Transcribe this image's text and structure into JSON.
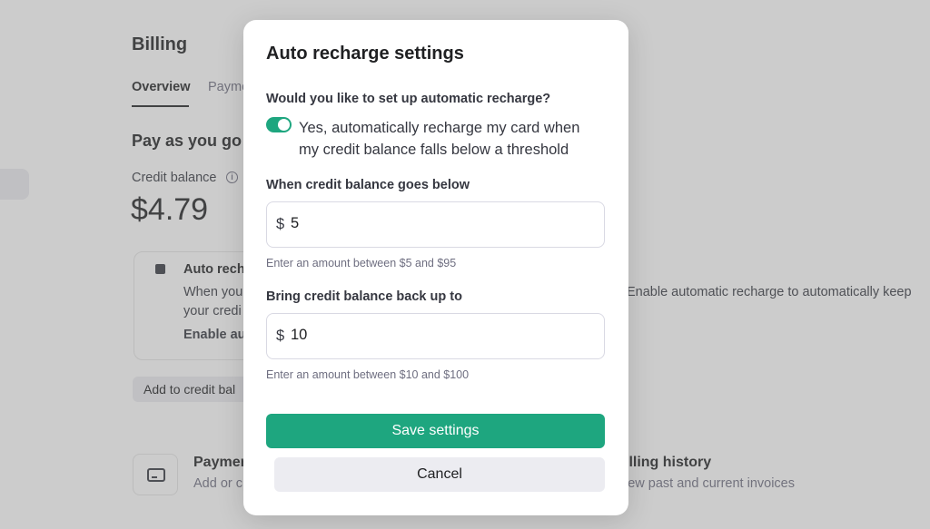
{
  "background": {
    "page_title": "Billing",
    "tabs": [
      {
        "label": "Overview"
      },
      {
        "label": "Payme"
      }
    ],
    "section_title": "Pay as you go",
    "credit_balance_label": "Credit balance",
    "info_icon": "info-icon",
    "credit_balance_amount": "$4.79",
    "auto_recharge_card": {
      "title": "Auto recha",
      "line1": "When you",
      "line2": "your credi",
      "link": "Enable au"
    },
    "auto_recharge_right_text": "Enable automatic recharge to automatically keep",
    "add_credit_button": "Add to credit bal",
    "payment_methods": {
      "icon": "credit-card-icon",
      "title": "Paymer",
      "subtitle": "Add or c"
    },
    "billing_history": {
      "title": "illing history",
      "subtitle": "iew past and current invoices"
    }
  },
  "modal": {
    "title": "Auto recharge settings",
    "question": "Would you like to set up automatic recharge?",
    "toggle": {
      "enabled": true,
      "color": "#1ea67f",
      "label": "Yes, automatically recharge my card when my credit balance falls below a threshold"
    },
    "threshold": {
      "label": "When credit balance goes below",
      "currency": "$",
      "value": "5",
      "hint": "Enter an amount between $5 and $95"
    },
    "recharge_to": {
      "label": "Bring credit balance back up to",
      "currency": "$",
      "value": "10",
      "hint": "Enter an amount between $10 and $100"
    },
    "save_label": "Save settings",
    "cancel_label": "Cancel",
    "accent_color": "#1ea67f"
  }
}
